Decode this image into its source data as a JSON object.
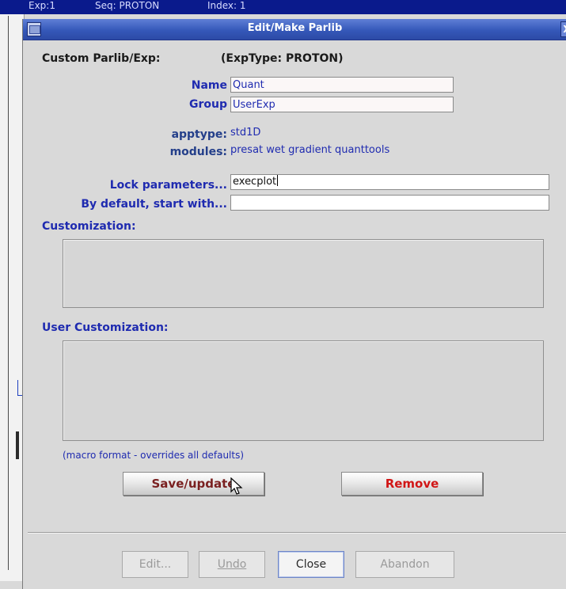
{
  "background_window": {
    "strip_text_1": "Exp:1",
    "strip_text_2": "Seq: PROTON",
    "strip_text_3": "Index: 1"
  },
  "dialog": {
    "title": "Edit/Make Parlib",
    "close_glyph": "X"
  },
  "header": {
    "label": "Custom Parlib/Exp:",
    "exp_type": "(ExpType: PROTON)"
  },
  "fields": {
    "name_label": "Name",
    "name_value": "Quant",
    "group_label": "Group",
    "group_value": "UserExp",
    "apptype_label": "apptype:",
    "apptype_value": "std1D",
    "modules_label": "modules:",
    "modules_value": "presat wet gradient quanttools",
    "lock_label": "Lock parameters...",
    "lock_value": "execplot",
    "default_label": "By default, start with...",
    "default_value": ""
  },
  "customization": {
    "label": "Customization:",
    "user_label": "User Customization:",
    "note": "(macro format - overrides all defaults)"
  },
  "actions": {
    "save_label": "Save/update",
    "remove_label": "Remove"
  },
  "bottom_buttons": {
    "edit": "Edit...",
    "undo": "Undo",
    "close": "Close",
    "abandon": "Abandon"
  },
  "colors": {
    "title_bar": "#3558b9",
    "label_blue": "#1f2bb0",
    "remove_red": "#d11616"
  }
}
